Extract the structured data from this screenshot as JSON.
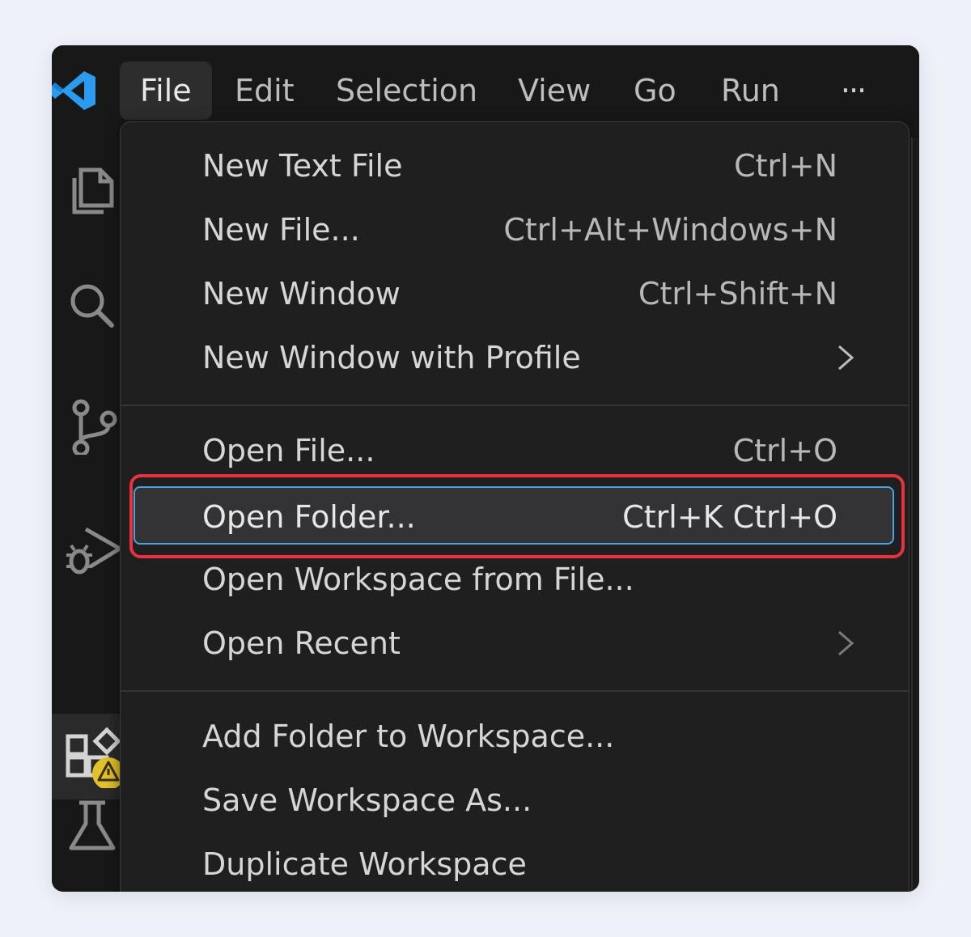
{
  "menubar": {
    "items": [
      {
        "label": "File"
      },
      {
        "label": "Edit"
      },
      {
        "label": "Selection"
      },
      {
        "label": "View"
      },
      {
        "label": "Go"
      },
      {
        "label": "Run"
      }
    ],
    "more": "···"
  },
  "file_menu": {
    "groups": [
      [
        {
          "label": "New Text File",
          "shortcut": "Ctrl+N"
        },
        {
          "label": "New File...",
          "shortcut": "Ctrl+Alt+Windows+N"
        },
        {
          "label": "New Window",
          "shortcut": "Ctrl+Shift+N"
        },
        {
          "label": "New Window with Profile",
          "shortcut": ""
        }
      ],
      [
        {
          "label": "Open File...",
          "shortcut": "Ctrl+O"
        },
        {
          "label": "Open Folder...",
          "shortcut": "Ctrl+K Ctrl+O"
        },
        {
          "label": "Open Workspace from File...",
          "shortcut": ""
        },
        {
          "label": "Open Recent",
          "shortcut": ""
        }
      ],
      [
        {
          "label": "Add Folder to Workspace...",
          "shortcut": ""
        },
        {
          "label": "Save Workspace As...",
          "shortcut": ""
        },
        {
          "label": "Duplicate Workspace",
          "shortcut": ""
        }
      ]
    ]
  },
  "activity_bar": {
    "icons": [
      "explorer-icon",
      "search-icon",
      "source-control-icon",
      "run-debug-icon",
      "extensions-icon",
      "testing-icon",
      "accounts-icon"
    ]
  },
  "colors": {
    "highlight_border": "#e8323f",
    "focus_border": "#4aa3df",
    "logo": "#2b9bf0",
    "warning_badge": "#e2c12a"
  }
}
